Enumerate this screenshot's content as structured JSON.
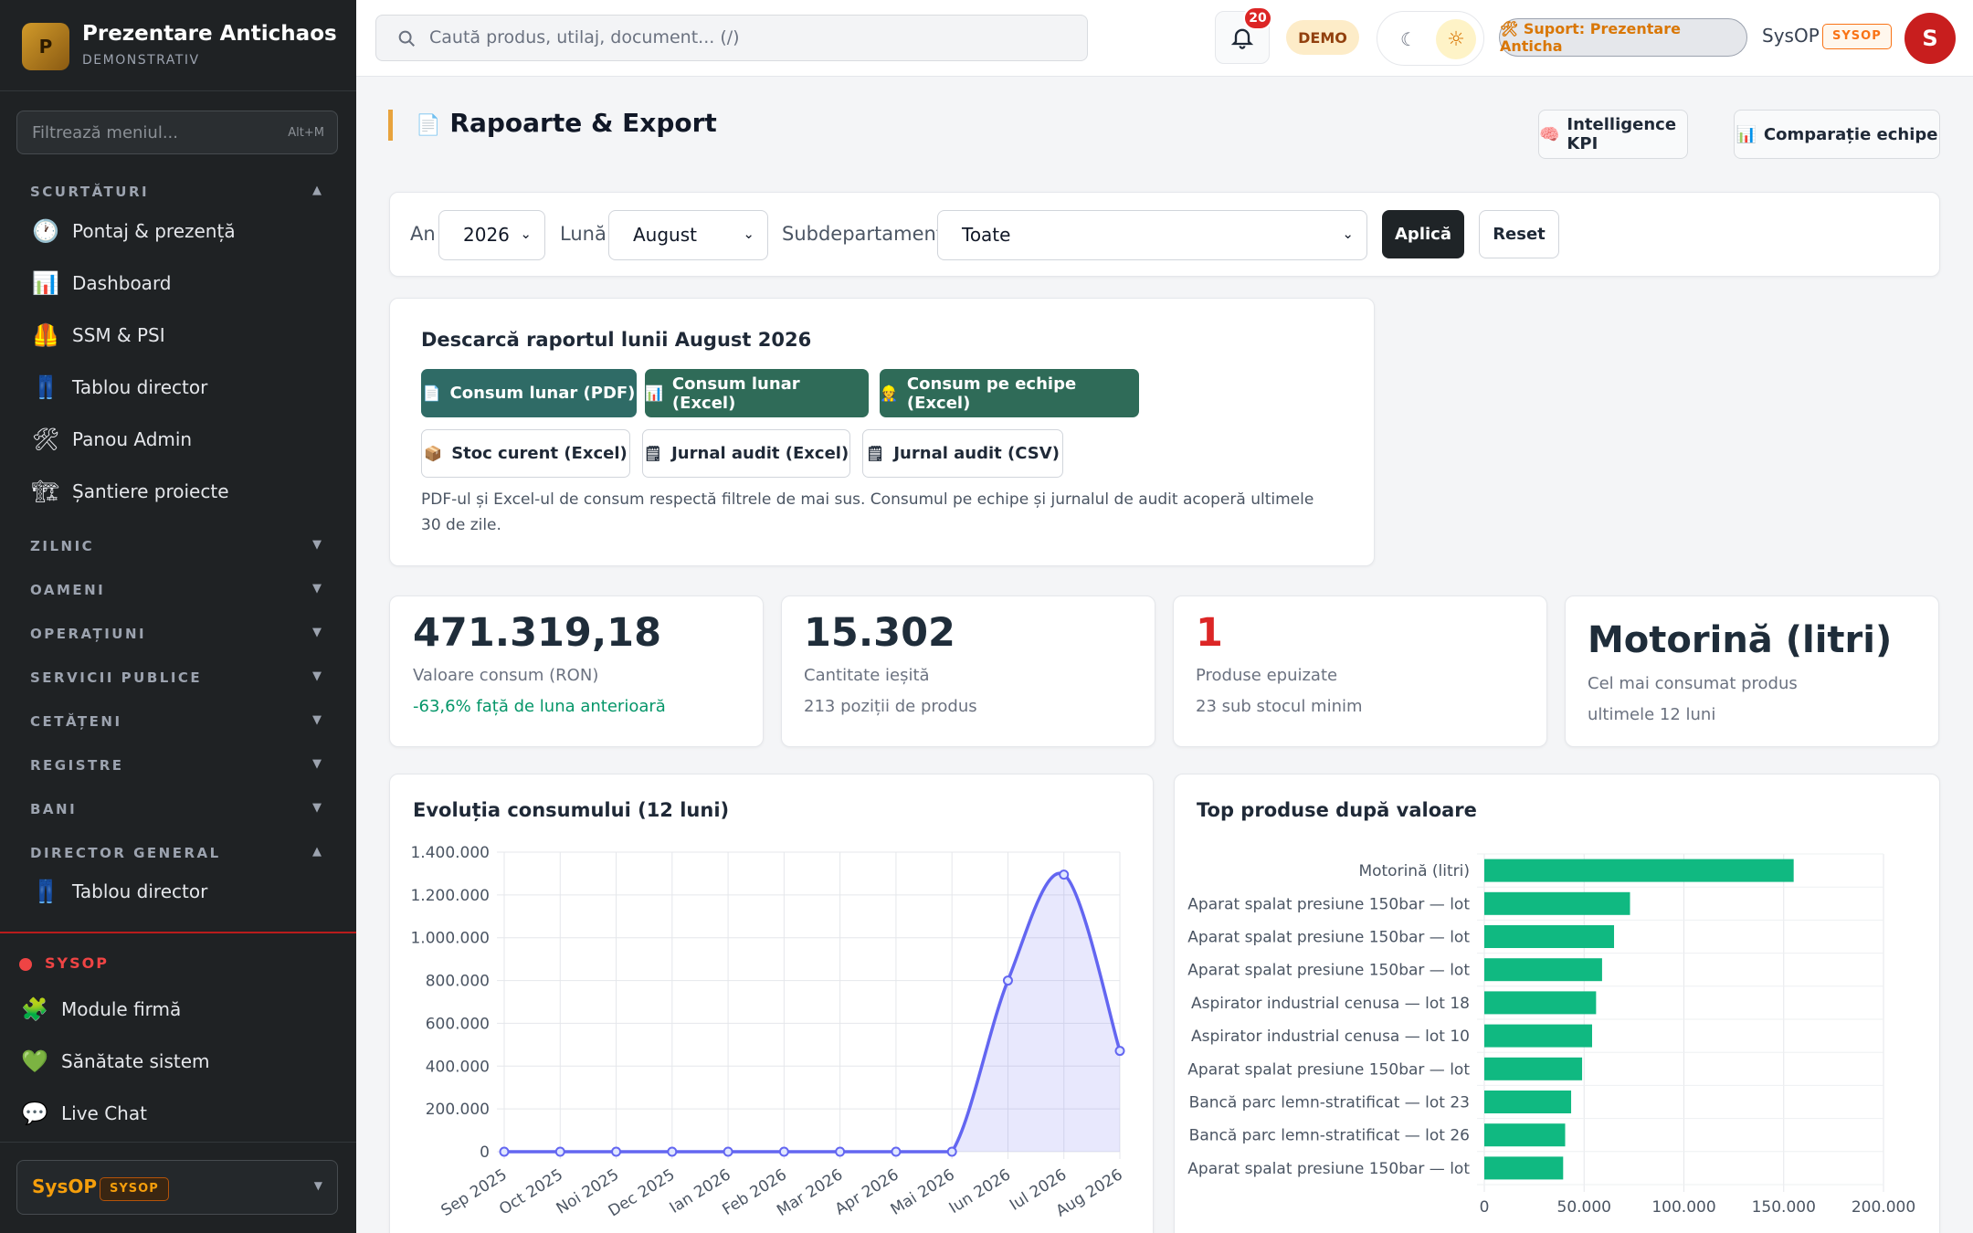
{
  "brand": {
    "logo_letter": "P",
    "title": "Prezentare Antichaos",
    "subtitle": "DEMONSTRATIV"
  },
  "sidebar": {
    "filter_placeholder": "Filtrează meniul...",
    "filter_shortcut": "Alt+M",
    "sections": [
      {
        "label": "SCURTĂTURI",
        "expanded": true,
        "items": [
          {
            "label": "Pontaj & prezență",
            "icon": "clock-icon"
          },
          {
            "label": "Dashboard",
            "icon": "bar-chart-icon"
          },
          {
            "label": "SSM & PSI",
            "icon": "safety-vest-icon"
          },
          {
            "label": "Tablou director",
            "icon": "jeans-icon"
          },
          {
            "label": "Panou Admin",
            "icon": "tools-icon"
          },
          {
            "label": "Șantiere proiecte",
            "icon": "crane-icon"
          }
        ]
      },
      {
        "label": "ZILNIC",
        "expanded": false
      },
      {
        "label": "OAMENI",
        "expanded": false
      },
      {
        "label": "OPERAȚIUNI",
        "expanded": false
      },
      {
        "label": "SERVICII PUBLICE",
        "expanded": false
      },
      {
        "label": "CETĂȚENI",
        "expanded": false
      },
      {
        "label": "REGISTRE",
        "expanded": false
      },
      {
        "label": "BANI",
        "expanded": false
      },
      {
        "label": "DIRECTOR GENERAL",
        "expanded": true,
        "items": [
          {
            "label": "Tablou director",
            "icon": "jeans-icon"
          }
        ]
      }
    ],
    "sysop": {
      "label": "SYSOP",
      "items": [
        {
          "label": "Module firmă",
          "icon": "puzzle-icon"
        },
        {
          "label": "Sănătate sistem",
          "icon": "heart-icon"
        },
        {
          "label": "Live Chat",
          "icon": "speech-bubble-icon"
        }
      ]
    },
    "user": {
      "name": "SysOP",
      "role": "SYSOP"
    }
  },
  "topbar": {
    "search_placeholder": "Caută produs, utilaj, document... (/)",
    "notifications": "20",
    "demo": "DEMO",
    "support": "🛠 Suport: Prezentare Anticha",
    "user": "SysOP",
    "role": "SYSOP",
    "avatar": "S"
  },
  "page": {
    "title": "Rapoarte & Export",
    "btn_kpi": "Intelligence KPI",
    "btn_compare": "Comparație echipe"
  },
  "filters": {
    "year_label": "An",
    "year": "2026",
    "month_label": "Lună",
    "month": "August",
    "sub_label": "Subdepartament",
    "sub": "Toate",
    "apply": "Aplică",
    "reset": "Reset"
  },
  "download": {
    "title": "Descarcă raportul lunii August 2026",
    "buttons": [
      "Consum lunar (PDF)",
      "Consum lunar (Excel)",
      "Consum pe echipe (Excel)",
      "Stoc curent (Excel)",
      "Jurnal audit (Excel)",
      "Jurnal audit (CSV)"
    ],
    "note": "PDF-ul și Excel-ul de consum respectă filtrele de mai sus. Consumul pe echipe și jurnalul de audit acoperă ultimele 30 de zile."
  },
  "kpis": [
    {
      "value": "471.319,18",
      "label": "Valoare consum (RON)",
      "sub": "-63,6% față de luna anterioară"
    },
    {
      "value": "15.302",
      "label": "Cantitate ieșită",
      "sub": "213 poziții de produs"
    },
    {
      "value": "1",
      "label": "Produse epuizate",
      "sub": "23 sub stocul minim"
    },
    {
      "value": "Motorină (litri)",
      "label": "Cel mai consumat produs",
      "sub": "ultimele 12 luni"
    }
  ],
  "colors": {
    "accent": "#e8a33d",
    "line": "#6366f1",
    "bar": "#10b981",
    "danger": "#dc2626",
    "positive": "#059669"
  },
  "chart_data": [
    {
      "type": "area",
      "title": "Evoluția consumului (12 luni)",
      "categories": [
        "Sep 2025",
        "Oct 2025",
        "Noi 2025",
        "Dec 2025",
        "Ian 2026",
        "Feb 2026",
        "Mar 2026",
        "Apr 2026",
        "Mai 2026",
        "Iun 2026",
        "Iul 2026",
        "Aug 2026"
      ],
      "values": [
        0,
        0,
        0,
        0,
        0,
        0,
        0,
        0,
        0,
        800000,
        1295000,
        471319
      ],
      "ylim": [
        0,
        1400000
      ],
      "yticks": [
        "0",
        "200.000",
        "400.000",
        "600.000",
        "800.000",
        "1.000.000",
        "1.200.000",
        "1.400.000"
      ],
      "grid": true
    },
    {
      "type": "bar",
      "orientation": "horizontal",
      "title": "Top produse după valoare",
      "categories": [
        "Motorină (litri)",
        "Aparat spalat presiune 150bar — lot",
        "Aparat spalat presiune 150bar — lot",
        "Aparat spalat presiune 150bar — lot",
        "Aspirator industrial cenusa — lot 18",
        "Aspirator industrial cenusa — lot 10",
        "Aparat spalat presiune 150bar — lot",
        "Bancă parc lemn-stratificat — lot 23",
        "Bancă parc lemn-stratificat — lot 26",
        "Aparat spalat presiune 150bar — lot"
      ],
      "values": [
        155000,
        73000,
        65000,
        59000,
        56000,
        54000,
        49000,
        43500,
        40500,
        39500
      ],
      "xlim": [
        0,
        200000
      ],
      "xticks": [
        "0",
        "50.000",
        "100.000",
        "150.000",
        "200.000"
      ],
      "grid": true
    }
  ]
}
